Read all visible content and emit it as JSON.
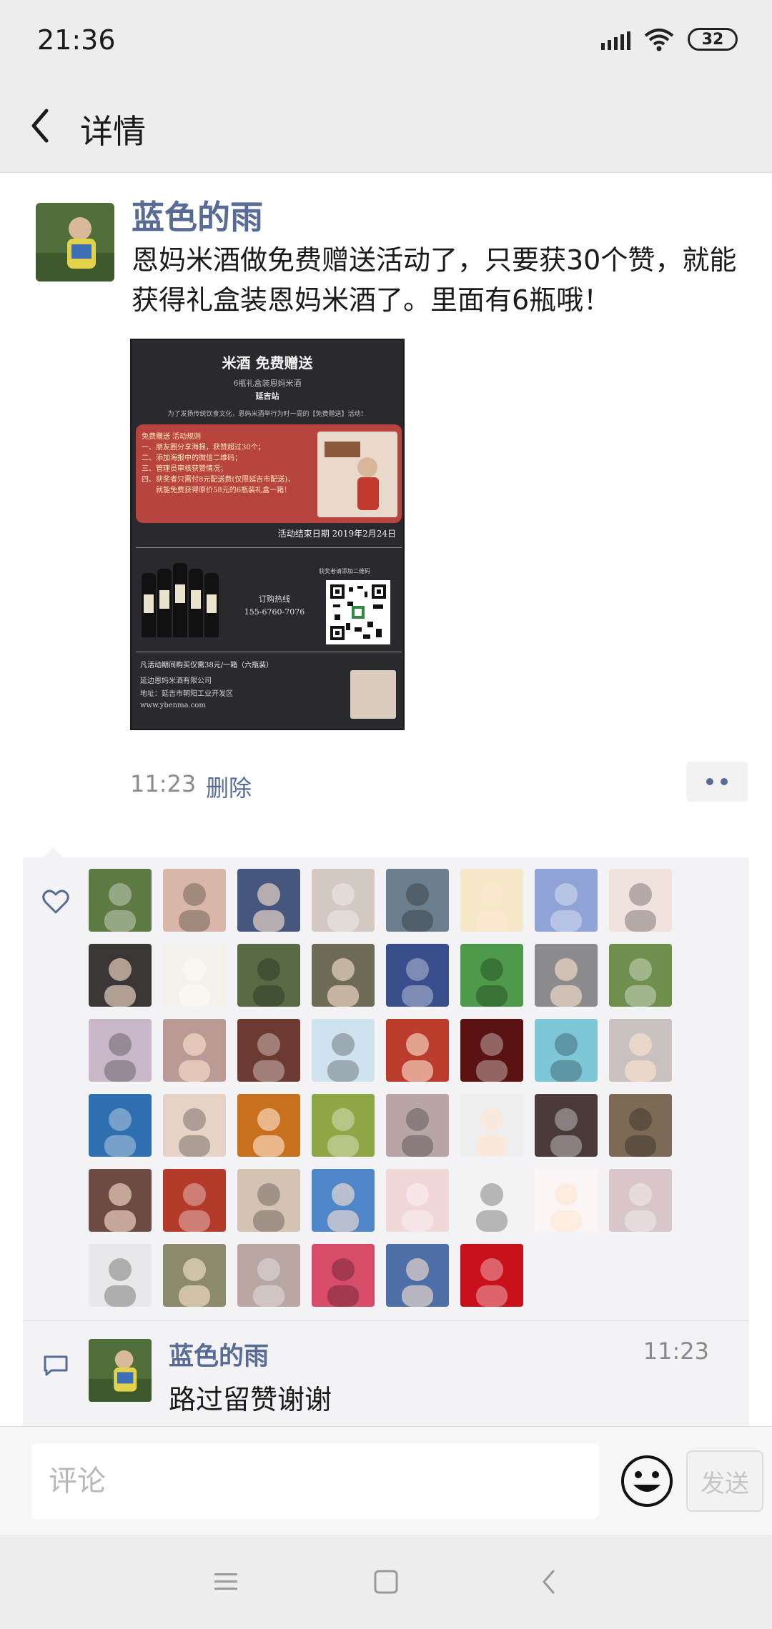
{
  "status_bar": {
    "time": "21:36",
    "battery": "32"
  },
  "header": {
    "title": "详情"
  },
  "post": {
    "author": "蓝色的雨",
    "text": "恩妈米酒做免费赠送活动了，只要获30个赞，就能获得礼盒装恩妈米酒了。里面有6瓶哦！",
    "time": "11:23",
    "delete_label": "删除",
    "image": {
      "title": "米酒 免费赠送",
      "subtitle": "6瓶礼盒装恩妈米酒",
      "station": "延吉站",
      "intro": "为了发扬传统饮食文化，恩妈米酒举行为时一周的【免费赠送】活动！",
      "rules": [
        "免费赠送 活动规则",
        "一、朋友圈分享海报，获赞超过30个；",
        "二、添加海报中的微信二维码；",
        "三、管理员审核获赞情况；",
        "四、获奖者只需付8元配送费(仅限延吉市配送)，",
        "　　就能免费获得原价58元的6瓶装礼盒一箱！"
      ],
      "end_date": "活动结束日期 2019年2月24日",
      "hotline_label": "订购热线",
      "hotline": "155-6760-7076",
      "qr_caption": "获奖者请添加二维码",
      "promo": "凡活动期间购买仅需38元/一箱（六瓶装）",
      "company": "延边恩妈米酒有限公司",
      "address": "地址：延吉市朝阳工业开发区",
      "website": "www.ybenma.com"
    }
  },
  "likes": {
    "avatar_colors": [
      "#5d7a45",
      "#d9b7a8",
      "#46577e",
      "#d3c8c2",
      "#6b7f8e",
      "#f5e8c8",
      "#8fa3d6",
      "#f0e2dc",
      "#3a3636",
      "#f4f1ea",
      "#586b45",
      "#6d6a56",
      "#3a4d8c",
      "#4e9a4a",
      "#8b8b8e",
      "#6f8f4c",
      "#c7b7c9",
      "#b99a94",
      "#6d3a32",
      "#cfe3ef",
      "#b93c2d",
      "#5a1212",
      "#7dc7d8",
      "#c9c1bf",
      "#2f6fb0",
      "#e6d3c6",
      "#c7711f",
      "#8ea646",
      "#b8a5a6",
      "#efeeee",
      "#4a3b3a",
      "#7c6a55",
      "#6e4a45",
      "#b43a2a",
      "#d4c2b3",
      "#4f86c8",
      "#f2d7d9",
      "#f3f3f3",
      "#fbf4f4",
      "#d8c6c9",
      "#e8e8ea",
      "#8b8a6d",
      "#b9a7a4",
      "#d84c6a",
      "#4d6ea6",
      "#c8101a"
    ]
  },
  "comment": {
    "author": "蓝色的雨",
    "time": "11:23",
    "text": "路过留赞谢谢"
  },
  "input_bar": {
    "placeholder": "评论",
    "send_label": "发送"
  }
}
